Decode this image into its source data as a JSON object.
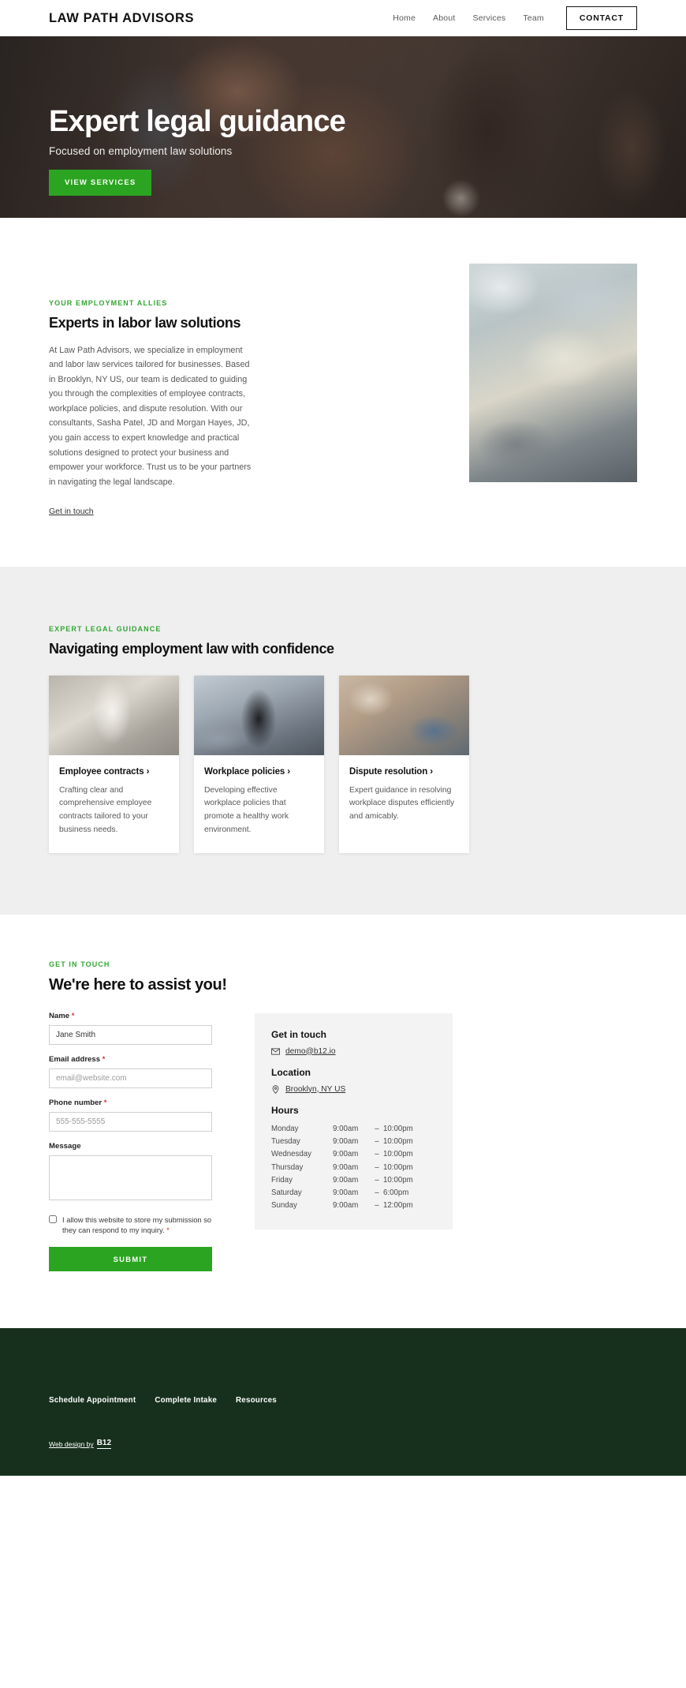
{
  "header": {
    "brand": "LAW PATH ADVISORS",
    "nav": [
      {
        "label": "Home"
      },
      {
        "label": "About"
      },
      {
        "label": "Services"
      },
      {
        "label": "Team"
      }
    ],
    "cta_label": "CONTACT"
  },
  "hero": {
    "title": "Expert legal guidance",
    "subtitle": "Focused on employment law solutions",
    "button_label": "VIEW SERVICES"
  },
  "about": {
    "eyebrow": "YOUR EMPLOYMENT ALLIES",
    "heading": "Experts in labor law solutions",
    "paragraph": "At Law Path Advisors, we specialize in employment and labor law services tailored for businesses. Based in Brooklyn, NY US, our team is dedicated to guiding you through the complexities of employee contracts, workplace policies, and dispute resolution. With our consultants, Sasha Patel, JD and Morgan Hayes, JD, you gain access to expert knowledge and practical solutions designed to protect your business and empower your workforce. Trust us to be your partners in navigating the legal landscape.",
    "link_label": "Get in touch"
  },
  "services": {
    "eyebrow": "EXPERT LEGAL GUIDANCE",
    "heading": "Navigating employment law with confidence",
    "cards": [
      {
        "title": "Employee contracts ›",
        "text": "Crafting clear and comprehensive employee contracts tailored to your business needs."
      },
      {
        "title": "Workplace policies ›",
        "text": "Developing effective workplace policies that promote a healthy work environment."
      },
      {
        "title": "Dispute resolution ›",
        "text": "Expert guidance in resolving workplace disputes efficiently and amicably."
      }
    ]
  },
  "contact": {
    "eyebrow": "GET IN TOUCH",
    "heading": "We're here to assist you!",
    "fields": {
      "name_label": "Name",
      "name_value": "Jane Smith",
      "email_label": "Email address",
      "email_placeholder": "email@website.com",
      "phone_label": "Phone number",
      "phone_placeholder": "555-555-5555",
      "message_label": "Message",
      "message_value": ""
    },
    "consent_text": "I allow this website to store my submission so they can respond to my inquiry.",
    "submit_label": "SUBMIT",
    "required_marker": "*",
    "info": {
      "get_in_touch_title": "Get in touch",
      "email": "demo@b12.io",
      "location_title": "Location",
      "location": "Brooklyn, NY US",
      "hours_title": "Hours",
      "hours": [
        {
          "day": "Monday",
          "open": "9:00am",
          "dash": "–",
          "close": "10:00pm"
        },
        {
          "day": "Tuesday",
          "open": "9:00am",
          "dash": "–",
          "close": "10:00pm"
        },
        {
          "day": "Wednesday",
          "open": "9:00am",
          "dash": "–",
          "close": "10:00pm"
        },
        {
          "day": "Thursday",
          "open": "9:00am",
          "dash": "–",
          "close": "10:00pm"
        },
        {
          "day": "Friday",
          "open": "9:00am",
          "dash": "–",
          "close": "10:00pm"
        },
        {
          "day": "Saturday",
          "open": "9:00am",
          "dash": "–",
          "close": "6:00pm"
        },
        {
          "day": "Sunday",
          "open": "9:00am",
          "dash": "–",
          "close": "12:00pm"
        }
      ]
    }
  },
  "footer": {
    "links": [
      {
        "label": "Schedule Appointment"
      },
      {
        "label": "Complete Intake"
      },
      {
        "label": "Resources"
      }
    ],
    "credit_text": "Web design by",
    "credit_badge": "B12"
  },
  "colors": {
    "accent_green": "#2ba521",
    "eyebrow_green": "#34a534",
    "footer_dark": "#17301d",
    "section_gray": "#eeefee",
    "required_red": "#d93025"
  }
}
